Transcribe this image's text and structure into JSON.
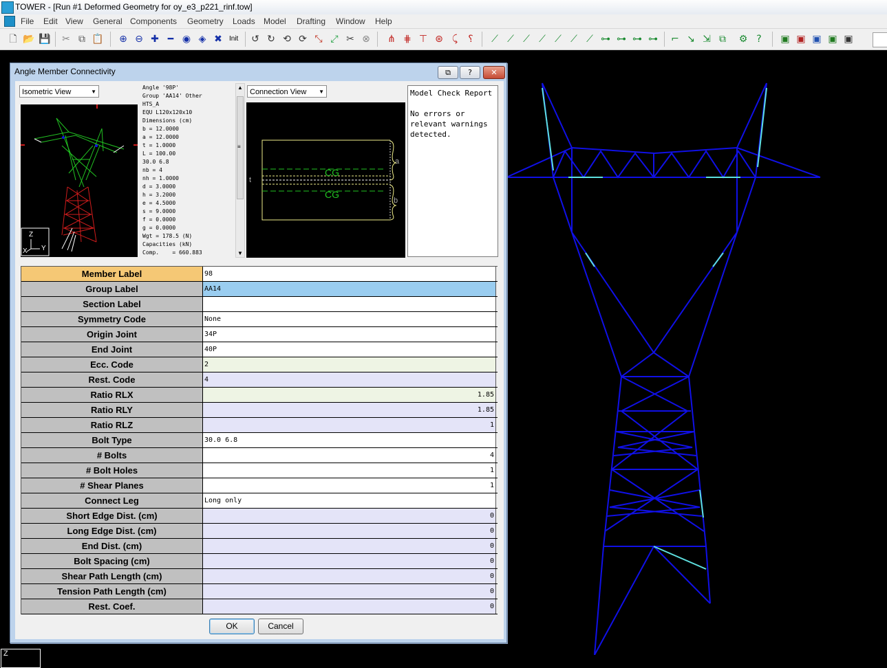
{
  "window": {
    "title": "TOWER  - [Run #1 Deformed Geometry for oy_e3_p221_rinf.tow]"
  },
  "menu": [
    "File",
    "Edit",
    "View",
    "General",
    "Components",
    "Geometry",
    "Loads",
    "Model",
    "Drafting",
    "Window",
    "Help"
  ],
  "toolbar": {
    "init_label": "Init"
  },
  "dialog": {
    "title": "Angle Member Connectivity",
    "iso_combo": "Isometric View",
    "conn_combo": "Connection View",
    "axis_labels": {
      "z": "Z",
      "x": "X",
      "y": "Y"
    },
    "connection_labels": {
      "cg_top": "CG",
      "cg_bottom": "CG",
      "a": "a",
      "b": "b",
      "t": "t"
    },
    "properties": [
      "Angle '98P'",
      "Group 'AA14' Other",
      "HTS_A",
      "EQU L120x120x10",
      "Dimensions (cm)",
      "b = 12.0000",
      "a = 12.0000",
      "t = 1.0000",
      "L = 100.00",
      "30.0 6.8",
      "nb = 4",
      "nh = 1.0000",
      "d = 3.0000",
      "h = 3.2000",
      "e = 4.5000",
      "s = 9.0000",
      "f = 0.0000",
      "g = 0.0000",
      "Wgt = 178.5 (N)",
      "Capacities (kN)",
      "Comp.    = 660.883"
    ],
    "report": {
      "title": "Model Check Report",
      "body": "No errors or relevant warnings detected."
    },
    "rows": [
      {
        "label": "Member Label",
        "value": "98",
        "bg": "white",
        "num": false,
        "hdr": true
      },
      {
        "label": "Group Label",
        "value": "AA14",
        "bg": "blue",
        "num": false
      },
      {
        "label": "Section Label",
        "value": "",
        "bg": "white",
        "num": false
      },
      {
        "label": "Symmetry Code",
        "value": "None",
        "bg": "white",
        "num": false
      },
      {
        "label": "Origin Joint",
        "value": "34P",
        "bg": "white",
        "num": false
      },
      {
        "label": "End Joint",
        "value": "40P",
        "bg": "white",
        "num": false
      },
      {
        "label": "Ecc. Code",
        "value": "2",
        "bg": "green",
        "num": false
      },
      {
        "label": "Rest. Code",
        "value": "4",
        "bg": "lav",
        "num": false
      },
      {
        "label": "Ratio RLX",
        "value": "1.85",
        "bg": "green",
        "num": true
      },
      {
        "label": "Ratio RLY",
        "value": "1.85",
        "bg": "lav",
        "num": true
      },
      {
        "label": "Ratio RLZ",
        "value": "1",
        "bg": "lav",
        "num": true
      },
      {
        "label": "Bolt Type",
        "value": "30.0 6.8",
        "bg": "white",
        "num": false
      },
      {
        "label": "# Bolts",
        "value": "4",
        "bg": "white",
        "num": true
      },
      {
        "label": "# Bolt Holes",
        "value": "1",
        "bg": "white",
        "num": true
      },
      {
        "label": "# Shear Planes",
        "value": "1",
        "bg": "white",
        "num": true
      },
      {
        "label": "Connect Leg",
        "value": "Long only",
        "bg": "white",
        "num": false
      },
      {
        "label": "Short Edge Dist. (cm)",
        "value": "0",
        "bg": "lav",
        "num": true
      },
      {
        "label": "Long Edge Dist. (cm)",
        "value": "0",
        "bg": "lav",
        "num": true
      },
      {
        "label": "End Dist. (cm)",
        "value": "0",
        "bg": "lav",
        "num": true
      },
      {
        "label": "Bolt Spacing (cm)",
        "value": "0",
        "bg": "lav",
        "num": true
      },
      {
        "label": "Shear Path Length (cm)",
        "value": "0",
        "bg": "lav",
        "num": true
      },
      {
        "label": "Tension Path Length (cm)",
        "value": "0",
        "bg": "lav",
        "num": true
      },
      {
        "label": "Rest. Coef.",
        "value": "0",
        "bg": "lav",
        "num": true
      }
    ],
    "ok_label": "OK",
    "cancel_label": "Cancel"
  },
  "viewport": {
    "axis_label": "Z"
  },
  "colors": {
    "tower_line": "#1010e6",
    "highlight": "#5ee0e0",
    "tower_upper_iso": "#22c422",
    "tower_lower_iso": "#d01c1c"
  }
}
